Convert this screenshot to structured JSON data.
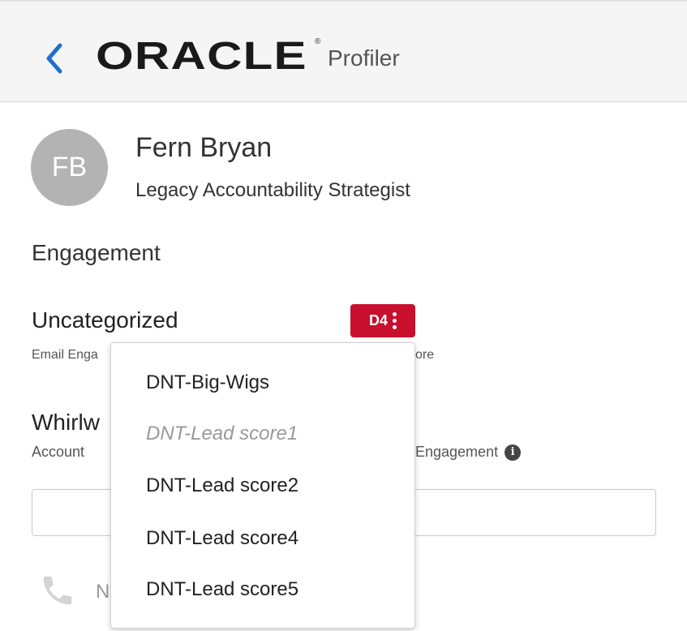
{
  "header": {
    "brand": "ORACLE",
    "registered": "®",
    "product": "Profiler"
  },
  "contact": {
    "initials": "FB",
    "name": "Fern Bryan",
    "title": "Legacy Accountability Strategist"
  },
  "engagement": {
    "section_title": "Engagement",
    "category": "Uncategorized",
    "sub_left": "Email Enga",
    "sub_right": "ore",
    "badge_label": "D4"
  },
  "account": {
    "title_partial": "Whirlw",
    "label": "Account",
    "engagement_label": "Engagement"
  },
  "phone": {
    "text_partial": "N"
  },
  "dropdown": {
    "items": [
      {
        "label": "DNT-Big-Wigs",
        "disabled": false
      },
      {
        "label": "DNT-Lead score1",
        "disabled": true
      },
      {
        "label": "DNT-Lead score2",
        "disabled": false
      },
      {
        "label": "DNT-Lead score4",
        "disabled": false
      },
      {
        "label": "DNT-Lead score5",
        "disabled": false
      }
    ]
  },
  "colors": {
    "accent_back": "#1f6fd1",
    "badge": "#c8102e"
  }
}
